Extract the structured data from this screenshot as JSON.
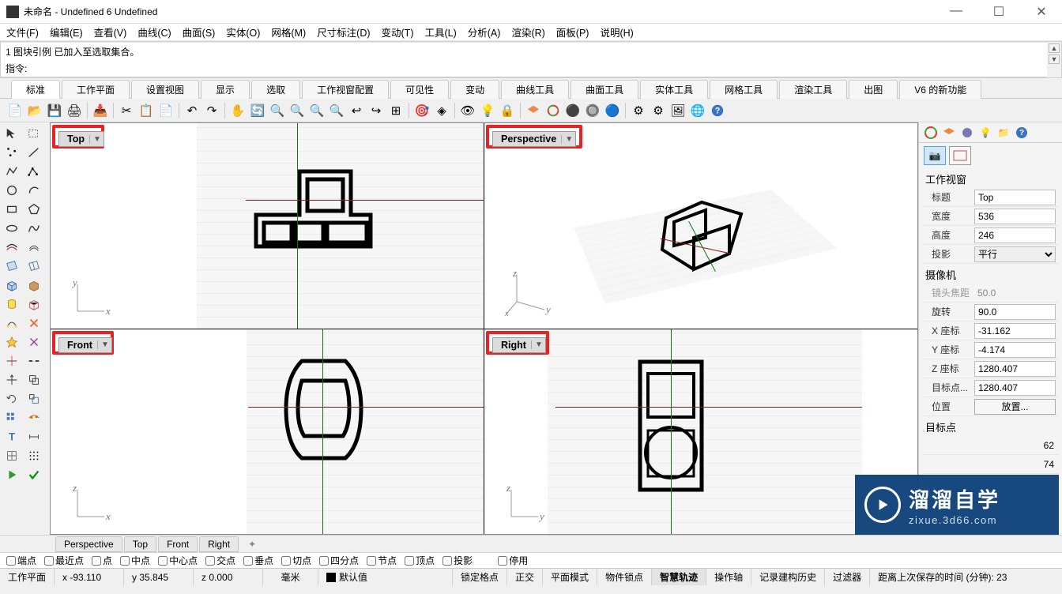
{
  "title": "未命名 - Undefined 6 Undefined",
  "menu": [
    "文件(F)",
    "编辑(E)",
    "查看(V)",
    "曲线(C)",
    "曲面(S)",
    "实体(O)",
    "网格(M)",
    "尺寸标注(D)",
    "变动(T)",
    "工具(L)",
    "分析(A)",
    "渲染(R)",
    "面板(P)",
    "说明(H)"
  ],
  "history_line": "1 图块引例 已加入至选取集合。",
  "cmd_label": "指令:",
  "tabs": [
    "标准",
    "工作平面",
    "设置视图",
    "显示",
    "选取",
    "工作视窗配置",
    "可见性",
    "变动",
    "曲线工具",
    "曲面工具",
    "实体工具",
    "网格工具",
    "渲染工具",
    "出图",
    "V6 的新功能"
  ],
  "active_tab": 0,
  "viewports": {
    "top": "Top",
    "perspective": "Perspective",
    "front": "Front",
    "right": "Right"
  },
  "bottom_tabs": [
    "Perspective",
    "Top",
    "Front",
    "Right"
  ],
  "panel": {
    "section1": "工作视窗",
    "props": [
      {
        "k": "标题",
        "v": "Top",
        "type": "input"
      },
      {
        "k": "宽度",
        "v": "536",
        "type": "input"
      },
      {
        "k": "高度",
        "v": "246",
        "type": "input"
      },
      {
        "k": "投影",
        "v": "平行",
        "type": "select"
      }
    ],
    "section2": "摄像机",
    "cam": [
      {
        "k": "镜头焦距",
        "v": "50.0",
        "type": "ro"
      },
      {
        "k": "旋转",
        "v": "90.0",
        "type": "input"
      },
      {
        "k": "X 座标",
        "v": "-31.162",
        "type": "input"
      },
      {
        "k": "Y 座标",
        "v": "-4.174",
        "type": "input"
      },
      {
        "k": "Z 座标",
        "v": "1280.407",
        "type": "input"
      },
      {
        "k": "目标点...",
        "v": "1280.407",
        "type": "input"
      },
      {
        "k": "位置",
        "v": "放置...",
        "type": "button"
      }
    ],
    "section3": "目标点",
    "extra_suffix1": "62",
    "extra_suffix2": "74"
  },
  "osnap": [
    "端点",
    "最近点",
    "点",
    "中点",
    "中心点",
    "交点",
    "垂点",
    "切点",
    "四分点",
    "节点",
    "顶点",
    "投影",
    "停用"
  ],
  "status": {
    "cplane": "工作平面",
    "x": "x -93.110",
    "y": "y 35.845",
    "z": "z 0.000",
    "unit": "毫米",
    "layer": "默认值",
    "items": [
      "锁定格点",
      "正交",
      "平面模式",
      "物件锁点",
      "智慧轨迹",
      "操作轴",
      "记录建构历史",
      "过滤器"
    ],
    "bold_item": "智慧轨迹",
    "timer": "距离上次保存的时间 (分钟): 23"
  },
  "watermark": {
    "cn": "溜溜自学",
    "en": "zixue.3d66.com"
  }
}
